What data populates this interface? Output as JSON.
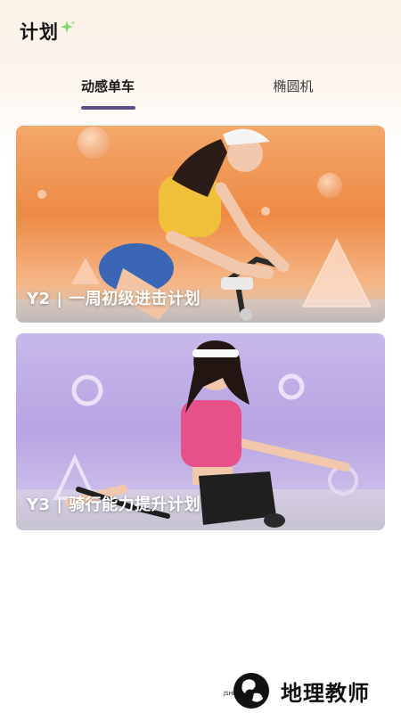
{
  "header": {
    "title": "计划",
    "sparkle_icon": "sparkle-icon",
    "sparkle_color": "#7fd86b"
  },
  "tabs": [
    {
      "label": "动感单车",
      "active": true
    },
    {
      "label": "椭圆机",
      "active": false
    }
  ],
  "accent_color": "#5a4f8a",
  "plans": [
    {
      "label": "Y2 | 一周初级进击计划",
      "theme": "orange"
    },
    {
      "label": "Y3 | 骑行能力提升计划",
      "theme": "purple"
    }
  ],
  "watermark": {
    "text": "地理教师",
    "ring_text": "JSHR",
    "logo_icon": "globe-logo-icon"
  }
}
